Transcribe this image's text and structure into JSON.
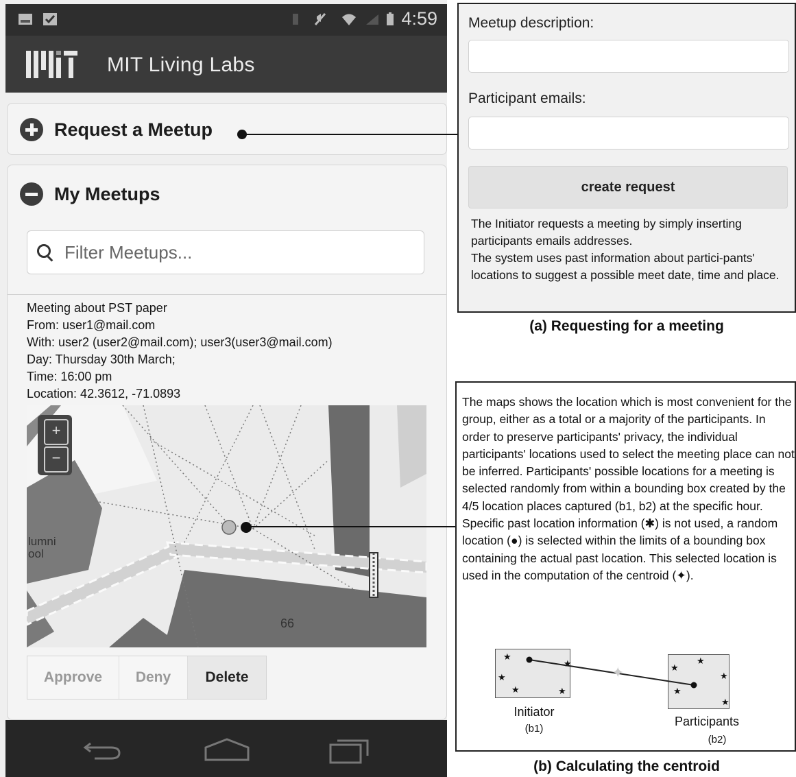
{
  "status_bar": {
    "time": "4:59"
  },
  "app": {
    "title": "MIT Living Labs"
  },
  "sections": {
    "request": {
      "label": "Request a Meetup"
    },
    "my_meetups": {
      "label": "My Meetups"
    }
  },
  "filter": {
    "placeholder": "Filter Meetups..."
  },
  "meeting": {
    "title": "Meeting about PST paper",
    "from": "From: user1@mail.com",
    "with": "With: user2 (user2@mail.com); user3(user3@mail.com)",
    "day": "Day: Thursday 30th March;",
    "time": "Time: 16:00 pm",
    "location": "Location: 42.3612, -71.0893"
  },
  "map": {
    "zoom_in": "+",
    "zoom_out": "−",
    "label_alumni": "lumni\nool",
    "label_building": "66"
  },
  "actions": {
    "approve": "Approve",
    "deny": "Deny",
    "delete": "Delete"
  },
  "form": {
    "description_label": "Meetup description:",
    "emails_label": "Participant emails:",
    "create_button": "create request",
    "explanation": "The Initiator requests a meeting by simply inserting participants emails addresses.\nThe system uses past information about partici-pants' locations to suggest a possible meet date, time and place."
  },
  "captions": {
    "a": "(a) Requesting for a meeting",
    "b": "(b) Calculating the centroid"
  },
  "centroid": {
    "text": "The maps shows the location which is most convenient for the group, either as a total or a majority of the participants. In order to preserve participants' privacy, the individual participants' locations used to select the meeting place can not be inferred. Participants' possible locations for a meeting is selected randomly from within a bounding box created by the 4/5 location places captured (b1, b2) at the specific hour. Specific past location information (✱) is not used, a random location (●) is selected within the limits of a bounding box containing the actual past location. This selected location is used  in the computation of the centroid (✦).",
    "initiator_label": "Initiator",
    "initiator_sub": "(b1)",
    "participants_label": "Participants",
    "participants_sub": "(b2)"
  },
  "colors": {
    "statusbar": "#2e2e2e",
    "appbar": "#3a3a3a",
    "panel": "#f4f4f4",
    "navbar": "#262626"
  }
}
